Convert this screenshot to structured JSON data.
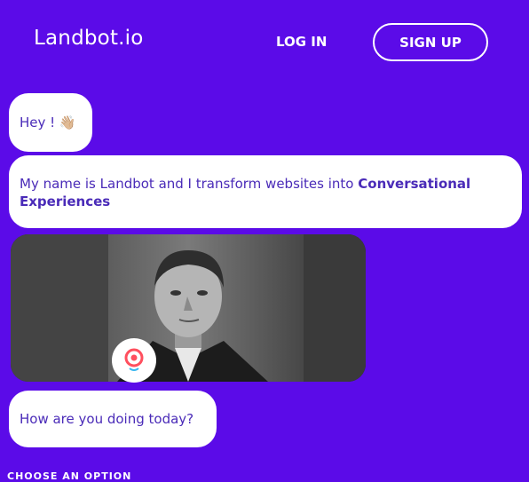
{
  "header": {
    "logo": "Landbot.io",
    "login_label": "LOG IN",
    "signup_label": "SIGN UP"
  },
  "chat": {
    "greeting": "Hey ! 👋🏼",
    "intro_plain": "My name is Landbot and I transform websites into ",
    "intro_bold": "Conversational Experiences",
    "question": "How are you doing today?"
  },
  "options": {
    "heading": "CHOOSE AN OPTION"
  },
  "colors": {
    "background": "#5b0be8",
    "bubble_text": "#4a2bb8",
    "bubble_bg": "#ffffff"
  }
}
